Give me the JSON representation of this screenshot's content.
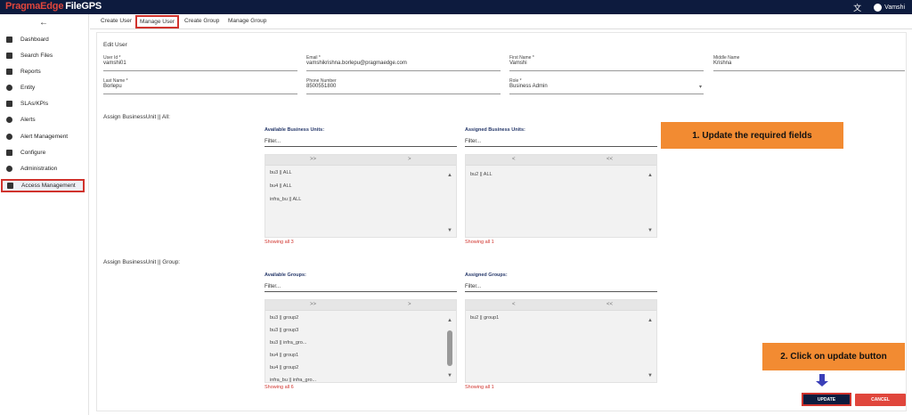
{
  "app": {
    "brand": "PragmaEdge",
    "product": "FileGPS",
    "user": "Vamshi"
  },
  "sidebar": {
    "items": [
      {
        "label": "Dashboard",
        "icon": "dashboard-icon"
      },
      {
        "label": "Search Files",
        "icon": "file-icon"
      },
      {
        "label": "Reports",
        "icon": "bar-chart-icon"
      },
      {
        "label": "Entity",
        "icon": "account-circle-icon"
      },
      {
        "label": "SLAs/KPIs",
        "icon": "list-icon"
      },
      {
        "label": "Alerts",
        "icon": "bell-icon"
      },
      {
        "label": "Alert Management",
        "icon": "alert-settings-icon"
      },
      {
        "label": "Configure",
        "icon": "configure-icon"
      },
      {
        "label": "Administration",
        "icon": "admin-icon"
      },
      {
        "label": "Access Management",
        "icon": "people-icon"
      }
    ]
  },
  "tabs": [
    "Create User",
    "Manage User",
    "Create Group",
    "Manage Group"
  ],
  "form": {
    "section": "Edit User",
    "fields": [
      {
        "label": "User Id *",
        "value": "vamshi01"
      },
      {
        "label": "Email *",
        "value": "vamshikrishna.borlepu@pragmaedge.com"
      },
      {
        "label": "First Name *",
        "value": "Vamshi"
      },
      {
        "label": "Middle Name",
        "value": "Krishna"
      },
      {
        "label": "Last Name *",
        "value": "Borlepu"
      },
      {
        "label": "Phone Number",
        "value": "8500551800"
      },
      {
        "label": "Role *",
        "value": "Business Admin"
      }
    ]
  },
  "bu": {
    "title": "Assign BusinessUnit || All:",
    "available_title": "Available Business Units:",
    "assigned_title": "Assigned Business Units:",
    "filter": "Filter...",
    "available": [
      "bu3 || ALL",
      "bu4 || ALL",
      "infra_bu || ALL"
    ],
    "assigned": [
      "bu2 || ALL"
    ],
    "available_count": "Showing all 3",
    "assigned_count": "Showing all 1"
  },
  "groups": {
    "title": "Assign BusinessUnit || Group:",
    "available_title": "Available Groups:",
    "assigned_title": "Assigned Groups:",
    "filter": "Filter...",
    "available": [
      "bu3 || group2",
      "bu3 || group3",
      "bu3 || infra_gro...",
      "bu4 || group1",
      "bu4 || group2",
      "infra_bu || infra_gro..."
    ],
    "assigned": [
      "bu2 || group1"
    ],
    "available_count": "Showing all 6",
    "assigned_count": "Showing all 1"
  },
  "controls": {
    "move_all_right": ">>",
    "move_right": ">",
    "move_left": "<",
    "move_all_left": "<<"
  },
  "callouts": {
    "step1": "1. Update the required fields",
    "step2": "2. Click on update button"
  },
  "buttons": {
    "update": "UPDATE",
    "cancel": "CANCEL"
  },
  "colors": {
    "header_bg": "#0d1b3e",
    "accent_red": "#d0332d",
    "callout_orange": "#f28b32",
    "arrow_blue": "#3a3fb8"
  }
}
